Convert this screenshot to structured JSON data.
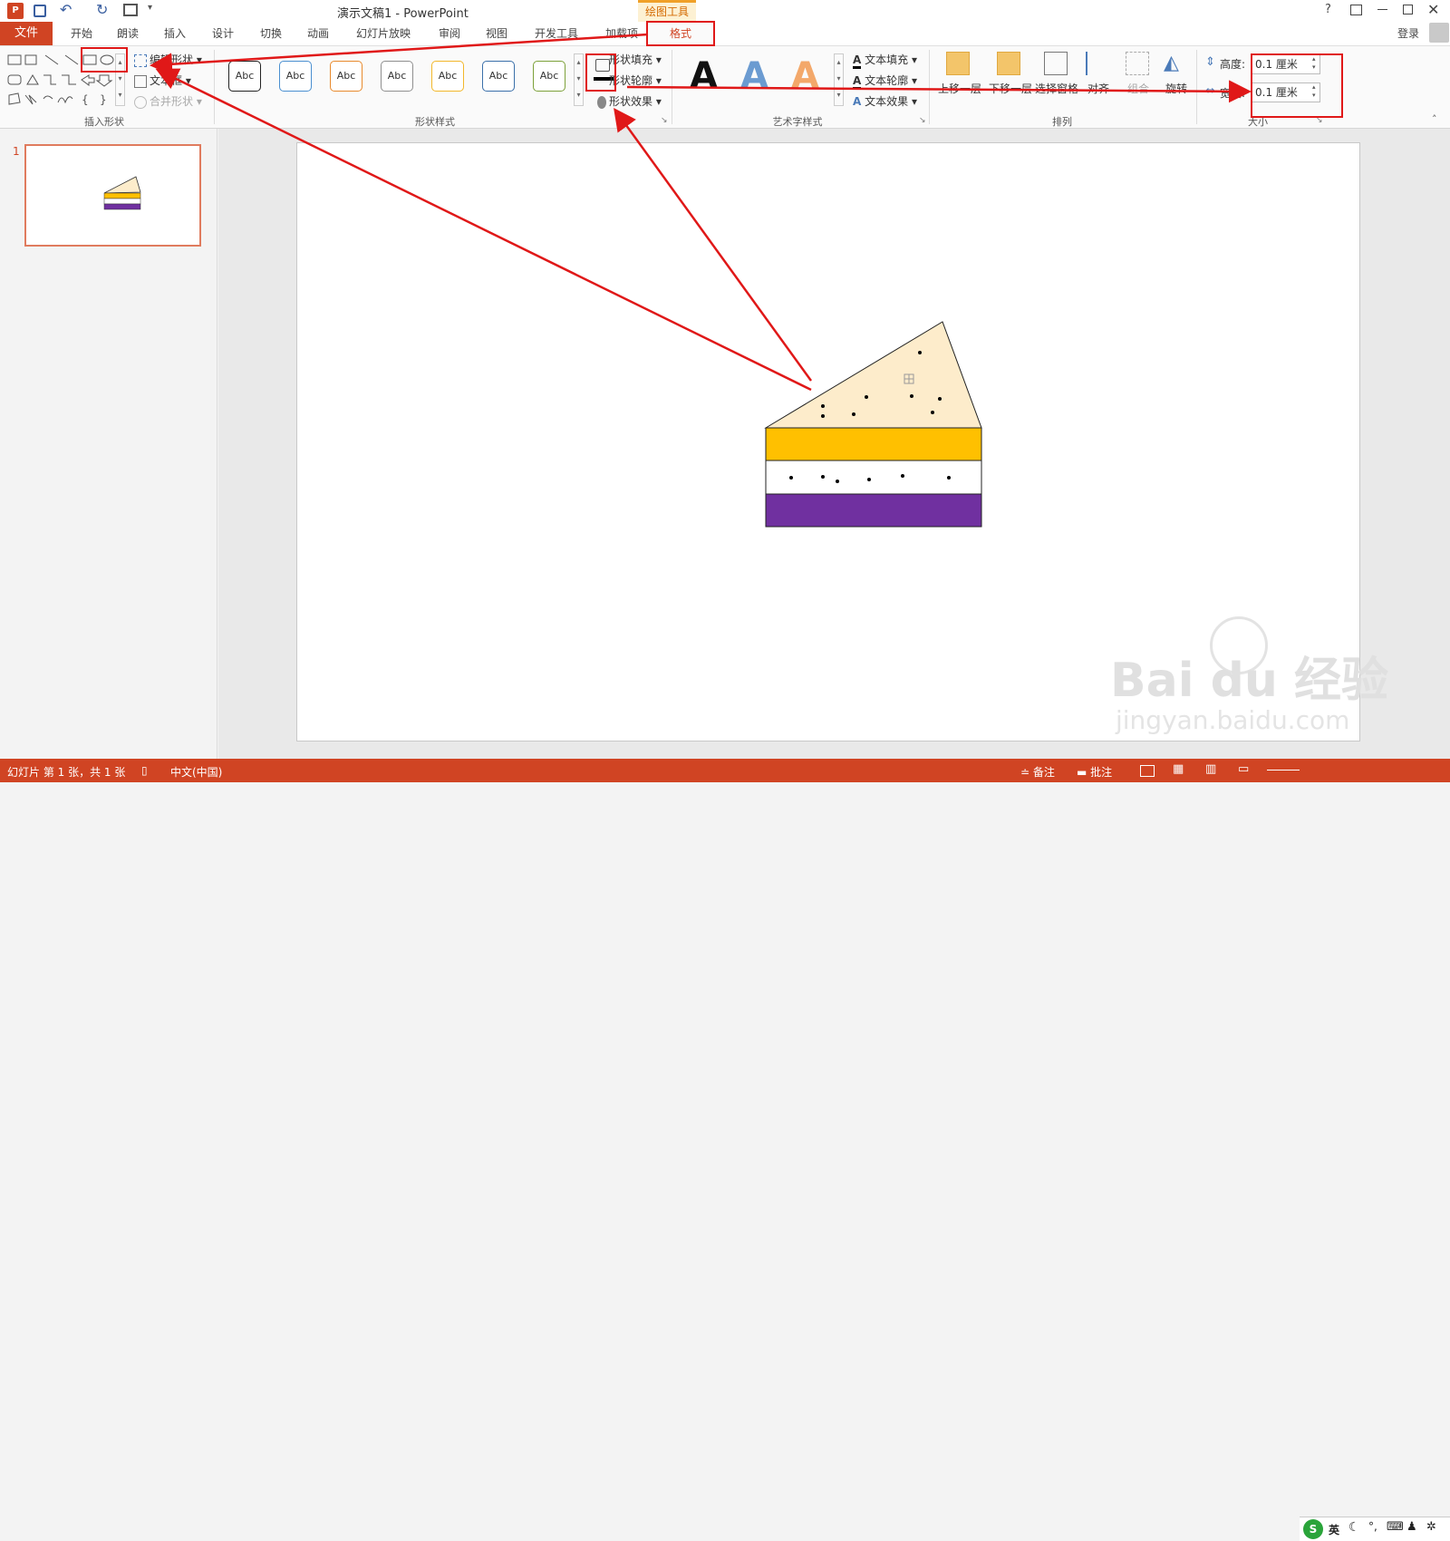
{
  "window": {
    "title": "演示文稿1 - PowerPoint",
    "context_tab": "绘图工具",
    "help": "?",
    "login": "登录"
  },
  "tabs": [
    "开始",
    "朗读",
    "插入",
    "设计",
    "切换",
    "动画",
    "幻灯片放映",
    "审阅",
    "视图",
    "开发工具",
    "加载项"
  ],
  "file_tab": "文件",
  "format_tab": "格式",
  "ribbon": {
    "insert_shapes": {
      "label": "插入形状",
      "edit_shape": "编辑形状",
      "text_box": "文本框",
      "merge_shapes": "合并形状"
    },
    "shape_styles": {
      "label": "形状样式",
      "presets": [
        "Abc",
        "Abc",
        "Abc",
        "Abc",
        "Abc",
        "Abc",
        "Abc"
      ],
      "preset_colors": [
        "#222222",
        "#4a8fd0",
        "#e88a2d",
        "#8f8f8f",
        "#f2b72b",
        "#3a6fa9",
        "#7da13a"
      ],
      "fill": "形状填充",
      "outline": "形状轮廓",
      "effects": "形状效果"
    },
    "wordart": {
      "label": "艺术字样式",
      "letters": [
        "A",
        "A",
        "A"
      ],
      "text_fill": "文本填充",
      "text_outline": "文本轮廓",
      "text_effects": "文本效果"
    },
    "arrange": {
      "label": "排列",
      "bring_forward": "上移一层",
      "send_backward": "下移一层",
      "selection_pane": "选择窗格",
      "align": "对齐",
      "group": "组合",
      "rotate": "旋转"
    },
    "size": {
      "label": "大小",
      "height_label": "高度:",
      "height_value": "0.1 厘米",
      "width_label": "宽度:",
      "width_value": "0.1 厘米"
    }
  },
  "thumbnails": [
    {
      "number": "1"
    }
  ],
  "slide": {
    "colors": {
      "top_slice": "#fdeccb",
      "yellow_layer": "#ffc000",
      "white_layer": "#ffffff",
      "purple_layer": "#7030a0"
    }
  },
  "statusbar": {
    "slide_info": "幻灯片 第 1 张，共 1 张",
    "language": "中文(中国)",
    "notes": "备注",
    "comments": "批注",
    "ime": "英"
  },
  "watermark": {
    "brand": "Bai du 经验",
    "url": "jingyan.baidu.com"
  }
}
